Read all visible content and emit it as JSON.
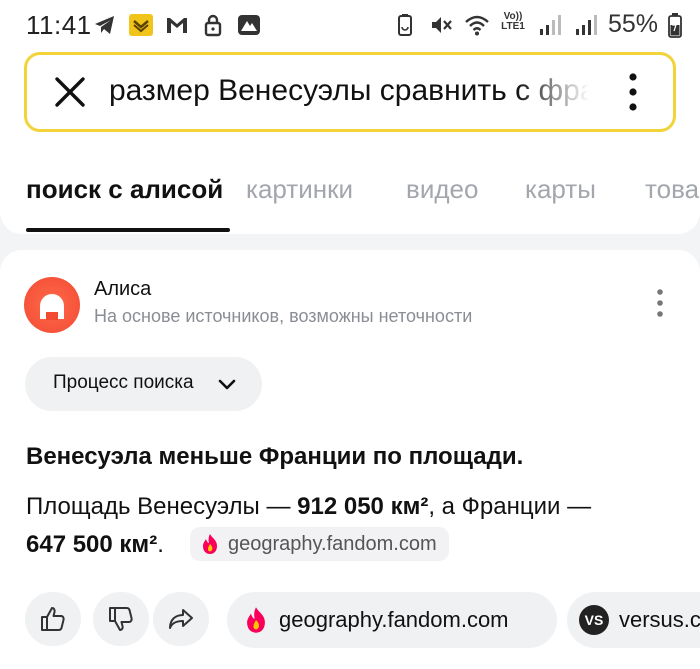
{
  "status_bar": {
    "time": "11:41",
    "left_icons": [
      "telegram-icon",
      "coin-app-icon",
      "gmail-icon",
      "lock-icon",
      "mountain-app-icon"
    ],
    "right_icons": [
      "battery-saver-icon",
      "mute-icon",
      "wifi-icon",
      "volte-icon",
      "signal-icon",
      "signal-icon"
    ],
    "volte_text": "Vo)) LTE1",
    "battery_percent": "55%"
  },
  "search": {
    "query": "размер Венесуэлы сравнить с франц"
  },
  "tabs": [
    {
      "label": "поиск с алисой",
      "active": true
    },
    {
      "label": "картинки",
      "active": false
    },
    {
      "label": "видео",
      "active": false
    },
    {
      "label": "карты",
      "active": false
    },
    {
      "label": "това",
      "active": false
    }
  ],
  "alice": {
    "name": "Алиса",
    "subtitle": "На основе источников, возможны неточности",
    "process_button": "Процесс поиска"
  },
  "answer": {
    "title": "Венесуэла меньше Франции по площади.",
    "line1_prefix": "Площадь Венесуэлы — ",
    "venezuela_area": "912 050 км²",
    "line1_suffix": ", а Франции —",
    "france_area": "647 500 км²",
    "line2_suffix": ".",
    "source_chip": "geography.fandom.com"
  },
  "actions": {
    "sources": [
      {
        "label": "geography.fandom.com",
        "icon": "fandom-icon"
      },
      {
        "label": "versus.c",
        "icon": "vs-icon"
      }
    ]
  },
  "colors": {
    "search_border": "#f2d33a",
    "alice_brand": "#f24a33",
    "fandom_flame": "#fa005a"
  }
}
